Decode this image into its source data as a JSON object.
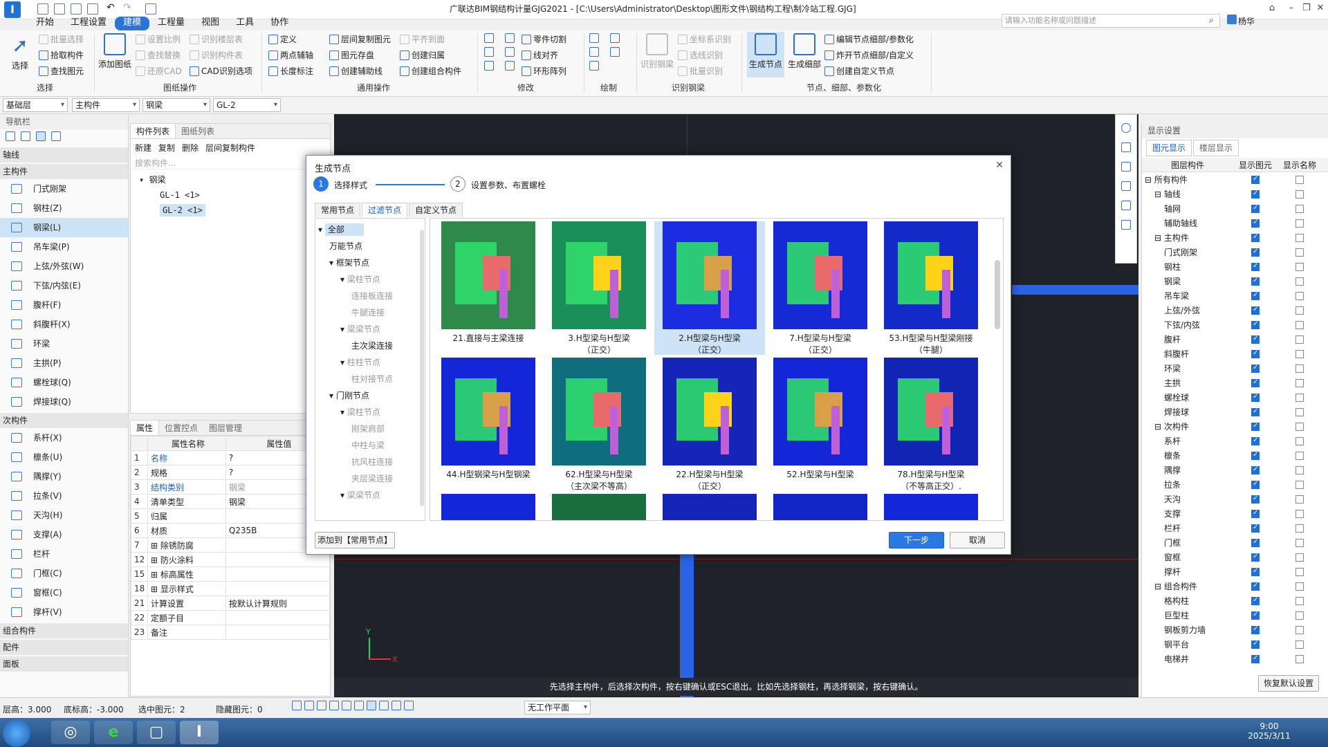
{
  "app": {
    "title": "广联达BIM钢结构计量GJG2021 - [C:\\Users\\Administrator\\Desktop\\图形文件\\钢结构工程\\制冷站工程.GJG]",
    "search_placeholder": "请输入功能名称或问题描述",
    "user": "杨华"
  },
  "menu": [
    "开始",
    "工程设置",
    "建模",
    "工程量",
    "视图",
    "工具",
    "协作"
  ],
  "ribbon": {
    "select": {
      "big": "选择",
      "items": [
        "批量选择",
        "拾取构件",
        "查找图元"
      ],
      "label": "选择"
    },
    "drawing": {
      "big": "添加图纸",
      "items": [
        "设置比例",
        "查找替换",
        "还原CAD",
        "识别楼层表",
        "识别构件表",
        "CAD识别选项"
      ],
      "label": "图纸操作"
    },
    "common": {
      "items": [
        "定义",
        "两点辅轴",
        "长度标注",
        "层间复制图元",
        "图元存盘",
        "创建辅助线",
        "平齐到面",
        "创建归属",
        "创建组合构件"
      ],
      "label": "通用操作"
    },
    "modify": {
      "items": [
        "零件切割",
        "线对齐",
        "环形阵列"
      ],
      "label": "修改"
    },
    "draw": {
      "label": "绘制"
    },
    "identify": {
      "big": "识别钢梁",
      "items": [
        "坐标系识别",
        "选线识别",
        "批量识别"
      ],
      "label": "识别钢梁"
    },
    "nodes": {
      "big1": "生成节点",
      "big2": "生成细部",
      "items": [
        "编辑节点细部/参数化",
        "炸开节点细部/自定义",
        "创建自定义节点"
      ],
      "label": "节点、细部、参数化"
    }
  },
  "selectors": [
    "基础层",
    "主构件",
    "钢梁",
    "GL-2"
  ],
  "nav": {
    "title": "导航栏",
    "sections": [
      {
        "name": "轴线",
        "items": []
      },
      {
        "name": "主构件",
        "items": [
          "门式刚架",
          "钢柱(Z)",
          "钢梁(L)",
          "吊车梁(P)",
          "上弦/外弦(W)",
          "下弦/内弦(E)",
          "腹杆(F)",
          "斜腹杆(X)",
          "环梁",
          "主拱(P)",
          "螺栓球(Q)",
          "焊接球(Q)"
        ]
      },
      {
        "name": "次构件",
        "items": [
          "系杆(X)",
          "檩条(U)",
          "隅撑(Y)",
          "拉条(V)",
          "天沟(H)",
          "支撑(A)",
          "栏杆",
          "门框(C)",
          "窗框(C)",
          "撑杆(V)"
        ]
      },
      {
        "name": "组合构件",
        "items": []
      },
      {
        "name": "配件",
        "items": []
      },
      {
        "name": "面板",
        "items": []
      }
    ]
  },
  "complist": {
    "tabs": [
      "构件列表",
      "图纸列表"
    ],
    "tools": [
      "新建",
      "复制",
      "删除",
      "层间复制构件"
    ],
    "search_placeholder": "搜索构件...",
    "tree": {
      "root": "钢梁",
      "children": [
        "GL-1 <1>",
        "GL-2 <1>"
      ]
    }
  },
  "props": {
    "tabs": [
      "属性",
      "位置控点",
      "图层管理"
    ],
    "headers": [
      "属性名称",
      "属性值"
    ],
    "rows": [
      {
        "n": "1",
        "name": "名称",
        "val": "?",
        "blue": true
      },
      {
        "n": "2",
        "name": "规格",
        "val": "?"
      },
      {
        "n": "3",
        "name": "结构类别",
        "val": "钢梁",
        "blue": true,
        "gray": true
      },
      {
        "n": "4",
        "name": "清单类型",
        "val": "钢梁"
      },
      {
        "n": "5",
        "name": "归属",
        "val": ""
      },
      {
        "n": "6",
        "name": "材质",
        "val": "Q235B"
      },
      {
        "n": "7",
        "name": "除锈防腐",
        "val": "",
        "plus": true
      },
      {
        "n": "12",
        "name": "防火涂料",
        "val": "",
        "plus": true
      },
      {
        "n": "15",
        "name": "标高属性",
        "val": "",
        "plus": true
      },
      {
        "n": "18",
        "name": "显示样式",
        "val": "",
        "plus": true
      },
      {
        "n": "21",
        "name": "计算设置",
        "val": "按默认计算规则"
      },
      {
        "n": "22",
        "name": "定额子目",
        "val": ""
      },
      {
        "n": "23",
        "name": "备注",
        "val": ""
      }
    ]
  },
  "canvas": {
    "cmd": "先选择主构件，后选择次构件，按右键确认或ESC退出。比如先选择钢柱，再选择钢梁，按右键确认。",
    "axis_y": "Y",
    "axis_x": "X"
  },
  "dialog": {
    "title": "生成节点",
    "steps": [
      {
        "n": "1",
        "label": "选择样式"
      },
      {
        "n": "2",
        "label": "设置参数、布置螺栓"
      }
    ],
    "tabs": [
      "常用节点",
      "过滤节点",
      "自定义节点"
    ],
    "tree": [
      {
        "t": "全部",
        "lvl": 0,
        "sel": true,
        "exp": true
      },
      {
        "t": "万能节点",
        "lvl": 1
      },
      {
        "t": "框架节点",
        "lvl": 1,
        "exp": true
      },
      {
        "t": "梁柱节点",
        "lvl": 2,
        "exp": true,
        "gray": true
      },
      {
        "t": "连接板连接",
        "lvl": 3,
        "gray": true
      },
      {
        "t": "牛腿连接",
        "lvl": 3,
        "gray": true
      },
      {
        "t": "梁梁节点",
        "lvl": 2,
        "exp": true,
        "gray": true
      },
      {
        "t": "主次梁连接",
        "lvl": 3
      },
      {
        "t": "柱柱节点",
        "lvl": 2,
        "exp": true,
        "gray": true
      },
      {
        "t": "柱对接节点",
        "lvl": 3,
        "gray": true
      },
      {
        "t": "门刚节点",
        "lvl": 1,
        "exp": true
      },
      {
        "t": "梁柱节点",
        "lvl": 2,
        "exp": true,
        "gray": true
      },
      {
        "t": "刚架肩部",
        "lvl": 3,
        "gray": true
      },
      {
        "t": "中柱与梁",
        "lvl": 3,
        "gray": true
      },
      {
        "t": "抗风柱连接",
        "lvl": 3,
        "gray": true
      },
      {
        "t": "夹层梁连接",
        "lvl": 3,
        "gray": true
      },
      {
        "t": "梁梁节点",
        "lvl": 2,
        "exp": true,
        "gray": true
      }
    ],
    "nodes": [
      {
        "l1": "21.直接与主梁连接",
        "l2": "",
        "c": "#2e8a4a"
      },
      {
        "l1": "3.H型梁与H型梁",
        "l2": "（正交）",
        "c": "#1b8f5a"
      },
      {
        "l1": "2.H型梁与H型梁",
        "l2": "（正交）",
        "c": "#1c2ce0",
        "sel": true
      },
      {
        "l1": "7.H型梁与H型梁",
        "l2": "（正交）",
        "c": "#1529d4"
      },
      {
        "l1": "53.H型梁与H型梁刚接",
        "l2": "（牛腿）",
        "c": "#1329c8"
      },
      {
        "l1": "44.H型钢梁与H型钢梁",
        "l2": "",
        "c": "#1326d8"
      },
      {
        "l1": "62.H型梁与H型梁",
        "l2": "（主次梁不等高）",
        "c": "#0f6e7e"
      },
      {
        "l1": "22.H型梁与H型梁",
        "l2": "（正交）",
        "c": "#1425b8"
      },
      {
        "l1": "52.H型梁与H型梁",
        "l2": "",
        "c": "#1326d8"
      },
      {
        "l1": "78.H型梁与H型梁",
        "l2": "（不等高正交）.",
        "c": "#1224b4"
      }
    ],
    "add_btn": "添加到【常用节点】",
    "next_btn": "下一步",
    "cancel_btn": "取消"
  },
  "display": {
    "title": "显示设置",
    "tabs": [
      "图元显示",
      "楼层显示"
    ],
    "headers": [
      "图层构件",
      "显示图元",
      "显示名称"
    ],
    "rows": [
      {
        "t": "所有构件",
        "g": true
      },
      {
        "t": "轴线",
        "g": true,
        "i": 1
      },
      {
        "t": "轴网",
        "i": 2
      },
      {
        "t": "辅助轴线",
        "i": 2
      },
      {
        "t": "主构件",
        "g": true,
        "i": 1
      },
      {
        "t": "门式刚架",
        "i": 2
      },
      {
        "t": "钢柱",
        "i": 2
      },
      {
        "t": "钢梁",
        "i": 2
      },
      {
        "t": "吊车梁",
        "i": 2
      },
      {
        "t": "上弦/外弦",
        "i": 2
      },
      {
        "t": "下弦/内弦",
        "i": 2
      },
      {
        "t": "腹杆",
        "i": 2
      },
      {
        "t": "斜腹杆",
        "i": 2
      },
      {
        "t": "环梁",
        "i": 2
      },
      {
        "t": "主拱",
        "i": 2
      },
      {
        "t": "螺栓球",
        "i": 2
      },
      {
        "t": "焊接球",
        "i": 2
      },
      {
        "t": "次构件",
        "g": true,
        "i": 1
      },
      {
        "t": "系杆",
        "i": 2
      },
      {
        "t": "檩条",
        "i": 2
      },
      {
        "t": "隅撑",
        "i": 2
      },
      {
        "t": "拉条",
        "i": 2
      },
      {
        "t": "天沟",
        "i": 2
      },
      {
        "t": "支撑",
        "i": 2
      },
      {
        "t": "栏杆",
        "i": 2
      },
      {
        "t": "门框",
        "i": 2
      },
      {
        "t": "窗框",
        "i": 2
      },
      {
        "t": "撑杆",
        "i": 2
      },
      {
        "t": "组合构件",
        "g": true,
        "i": 1
      },
      {
        "t": "格构柱",
        "i": 2
      },
      {
        "t": "巨型柱",
        "i": 2
      },
      {
        "t": "钢板剪力墙",
        "i": 2
      },
      {
        "t": "钢平台",
        "i": 2
      },
      {
        "t": "电梯井",
        "i": 2
      }
    ],
    "reset": "恢复默认设置"
  },
  "status": {
    "floor_h": "层高：3.000",
    "bottom": "底标高：-3.000",
    "selected": "选中图元：2",
    "hidden": "隐藏图元：0",
    "workplane": "无工作平面"
  },
  "taskbar": {
    "time": "9:00",
    "date": "2025/3/11"
  }
}
